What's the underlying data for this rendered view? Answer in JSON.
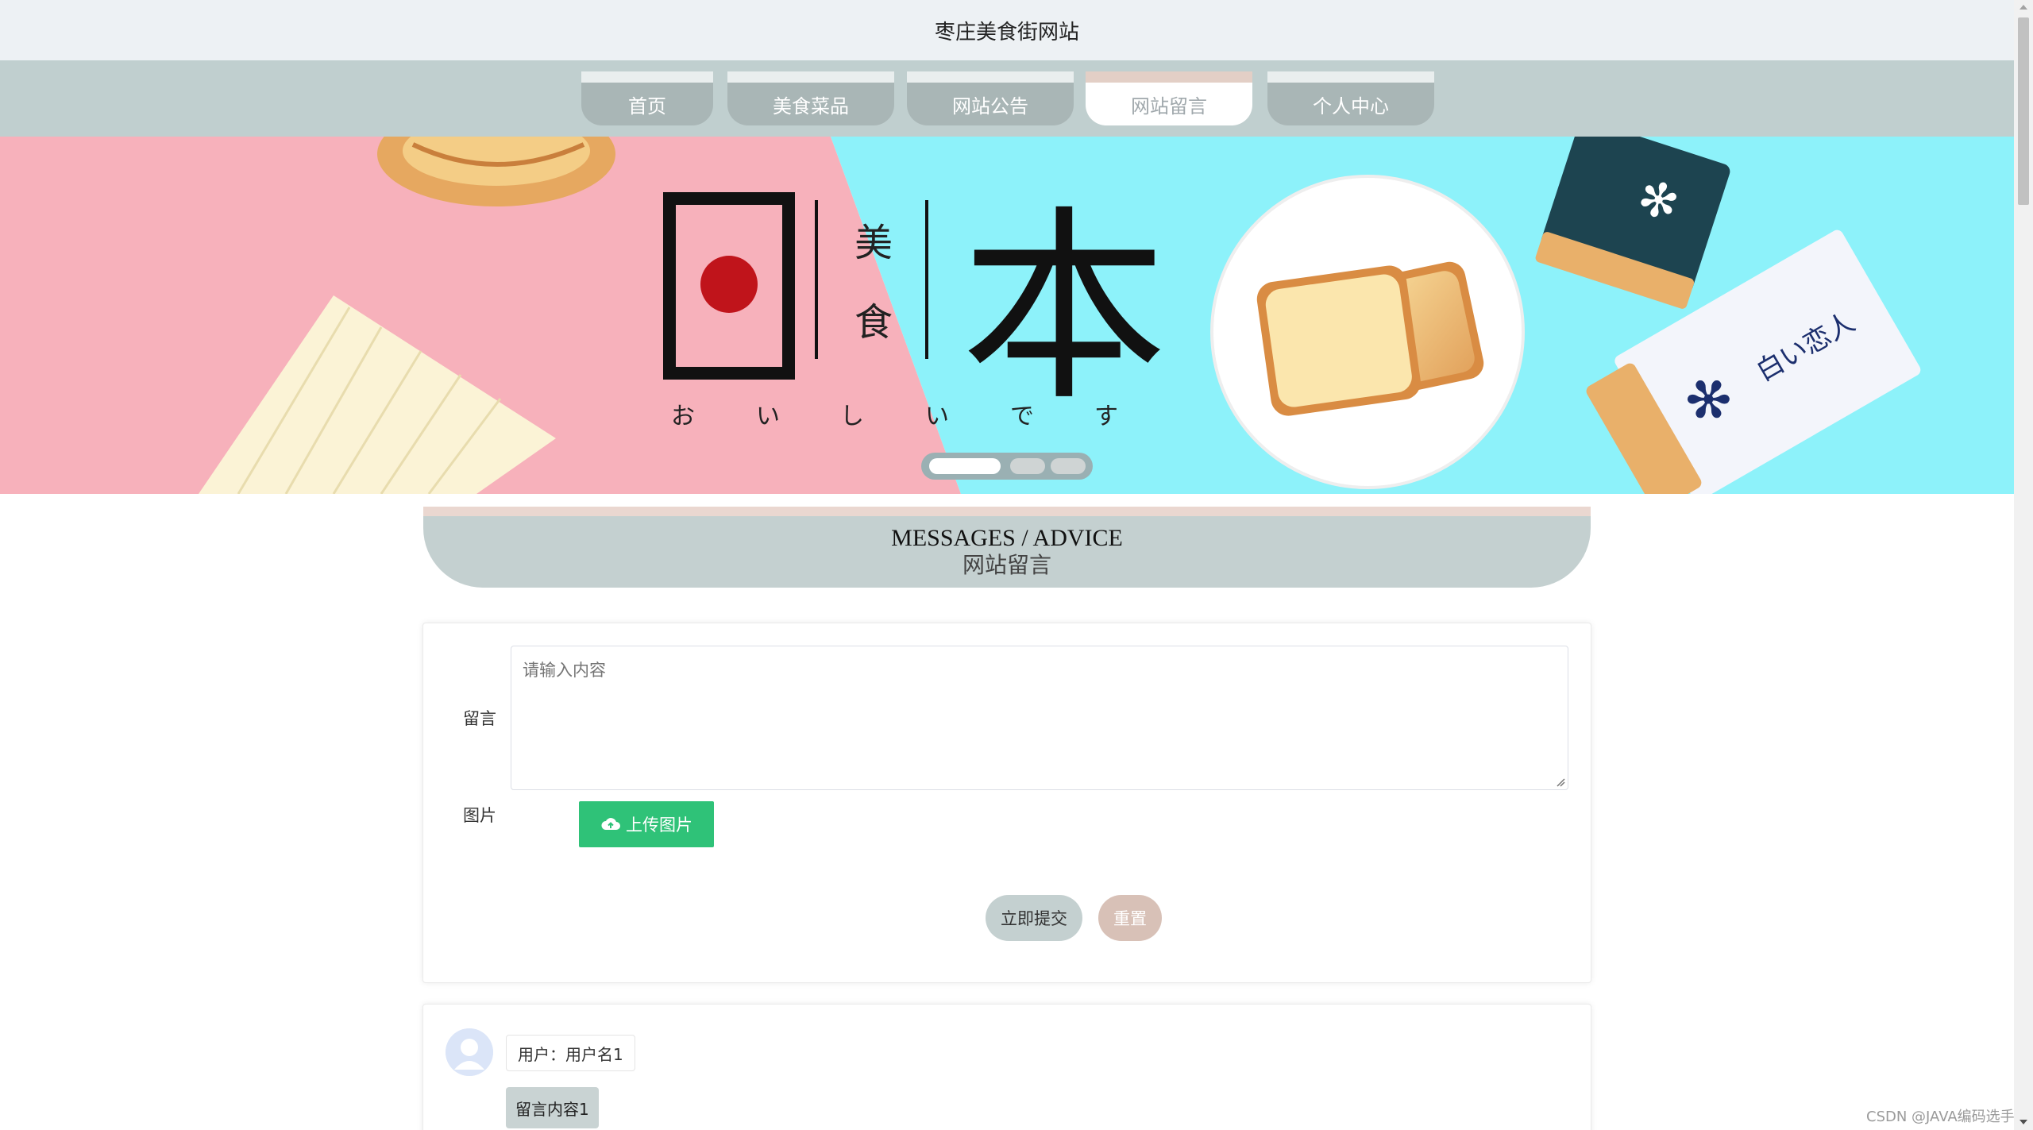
{
  "header": {
    "site_title": "枣庄美食街网站"
  },
  "nav": {
    "items": [
      {
        "label": "首页",
        "active": false
      },
      {
        "label": "美食菜品",
        "active": false
      },
      {
        "label": "网站公告",
        "active": false
      },
      {
        "label": "网站留言",
        "active": true
      },
      {
        "label": "个人中心",
        "active": false
      }
    ]
  },
  "banner": {
    "title_left": "日",
    "title_right": "本",
    "side_text": [
      "美",
      "食"
    ],
    "kana": [
      "お",
      "い",
      "し",
      "い",
      "で",
      "す"
    ],
    "package_text": "白い恋人",
    "colors": {
      "left_bg": "#f7b1bb",
      "right_bg": "#8df2fa",
      "red_dot": "#c0141b"
    },
    "slide_count": 3,
    "active_slide": 1
  },
  "section": {
    "title_en": "MESSAGES / ADVICE",
    "title_cn": "网站留言"
  },
  "form": {
    "message_label": "留言",
    "message_placeholder": "请输入内容",
    "image_label": "图片",
    "upload_label": "上传图片",
    "submit_label": "立即提交",
    "reset_label": "重置"
  },
  "messages": [
    {
      "user_label": "用户：用户名1",
      "content": "留言内容1"
    }
  ],
  "watermark": "CSDN @JAVA编码选手",
  "colors": {
    "titlebar_bg": "#edf1f4",
    "nav_bg": "#c0cfcf",
    "upload_green": "#2fc278",
    "reset_bg": "#d8c1b7"
  }
}
